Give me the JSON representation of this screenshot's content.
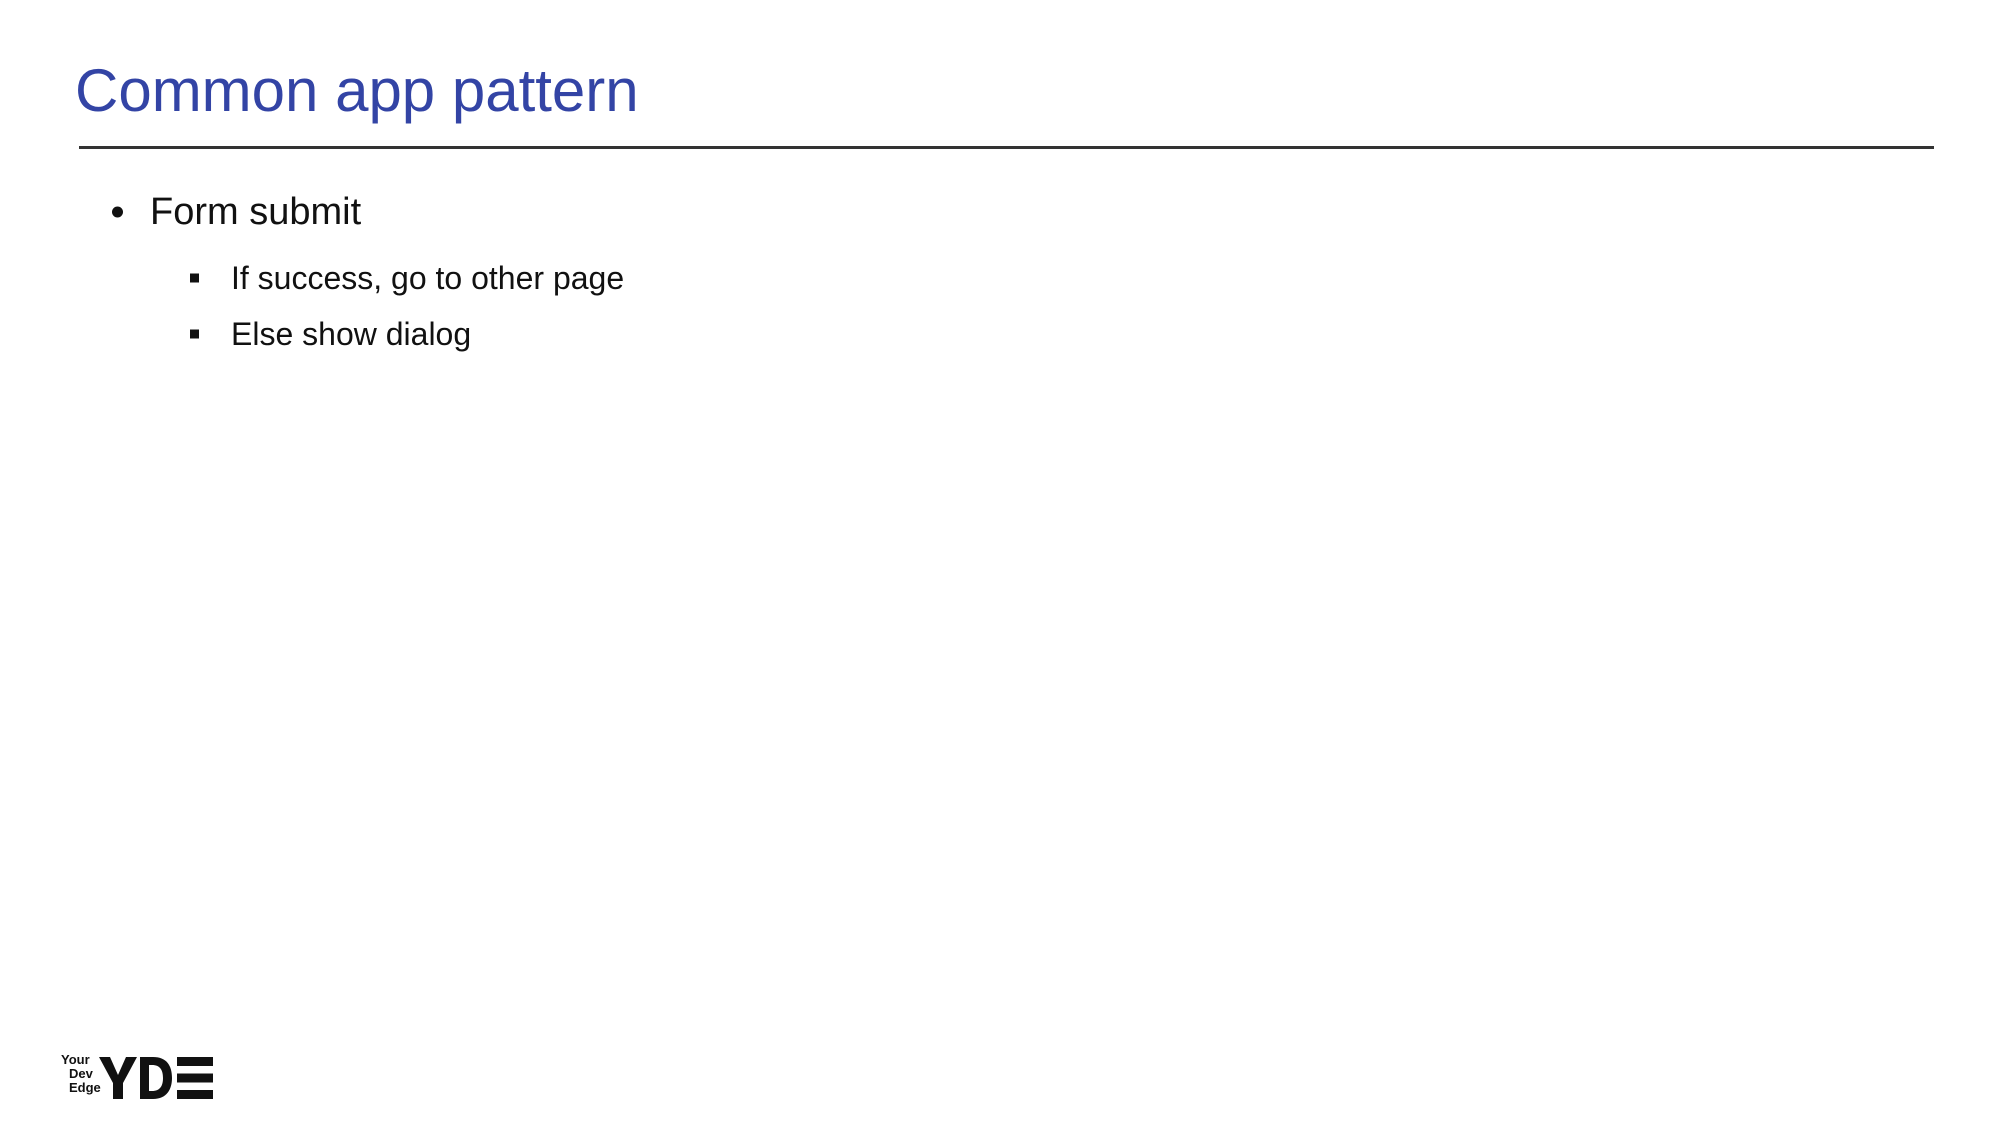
{
  "slide": {
    "title": "Common app pattern",
    "bullets": [
      {
        "text": "Form submit",
        "children": [
          {
            "text": "If success, go to other page"
          },
          {
            "text": "Else show dialog"
          }
        ]
      }
    ]
  },
  "logo": {
    "words": [
      "Your",
      "Dev",
      "Edge"
    ],
    "mark": "YDE"
  },
  "colors": {
    "title": "#3344a5",
    "rule": "#333333",
    "text": "#111111",
    "background": "#ffffff"
  }
}
